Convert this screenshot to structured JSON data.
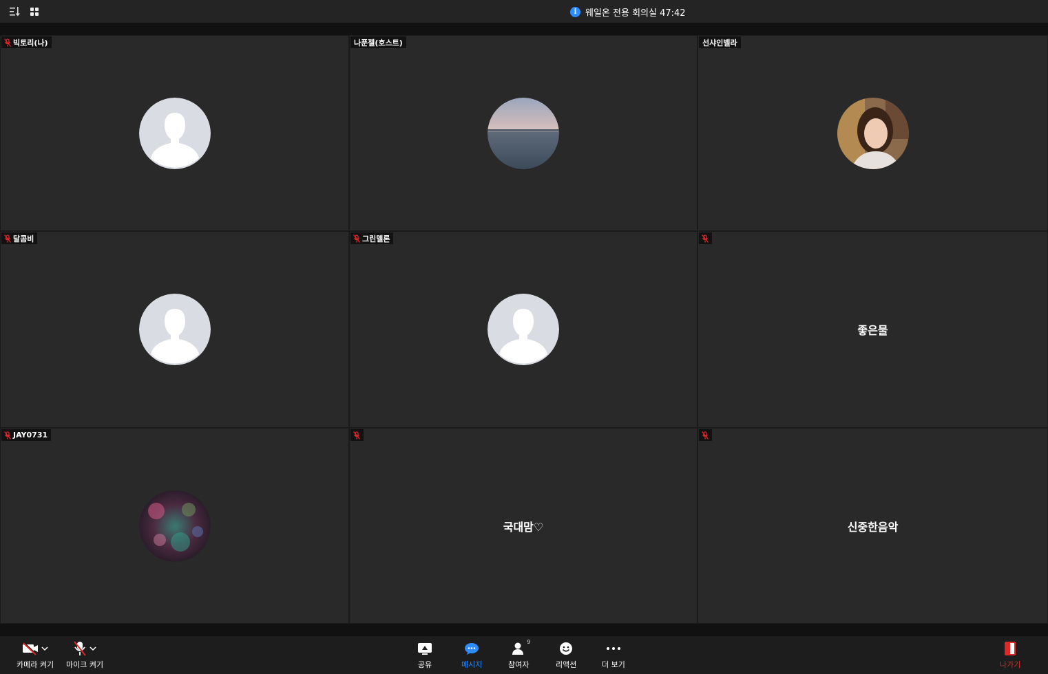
{
  "header": {
    "meeting_title": "웨일온 전용 회의실 47:42",
    "icons": [
      "sort-icon",
      "grid-view-icon",
      "info-icon"
    ]
  },
  "participants": [
    {
      "name": "빅토리(나)",
      "muted": true,
      "display": "avatar-default"
    },
    {
      "name": "나푼젤(호스트)",
      "muted": false,
      "display": "avatar-photo-sea"
    },
    {
      "name": "선샤인벨라",
      "muted": false,
      "display": "avatar-photo-person"
    },
    {
      "name": "달콤비",
      "muted": true,
      "display": "avatar-default"
    },
    {
      "name": "그린멜론",
      "muted": true,
      "display": "avatar-default"
    },
    {
      "name": "좋은물",
      "muted": true,
      "display": "name-only"
    },
    {
      "name": "JAY0731",
      "muted": true,
      "display": "avatar-photo-colorful"
    },
    {
      "name": "국대맘♡",
      "muted": true,
      "display": "name-only"
    },
    {
      "name": "신중한음악",
      "muted": true,
      "display": "name-only"
    }
  ],
  "toolbar": {
    "camera_label": "카메라 켜기",
    "mic_label": "마이크 켜기",
    "share_label": "공유",
    "message_label": "메시지",
    "participants_label": "참여자",
    "participants_count": "9",
    "reaction_label": "리액션",
    "more_label": "더 보기",
    "leave_label": "나가기"
  },
  "colors": {
    "accent": "#2d8cff",
    "leave": "#e02828",
    "muted_icon": "#e02828",
    "tile_bg": "#292929"
  }
}
